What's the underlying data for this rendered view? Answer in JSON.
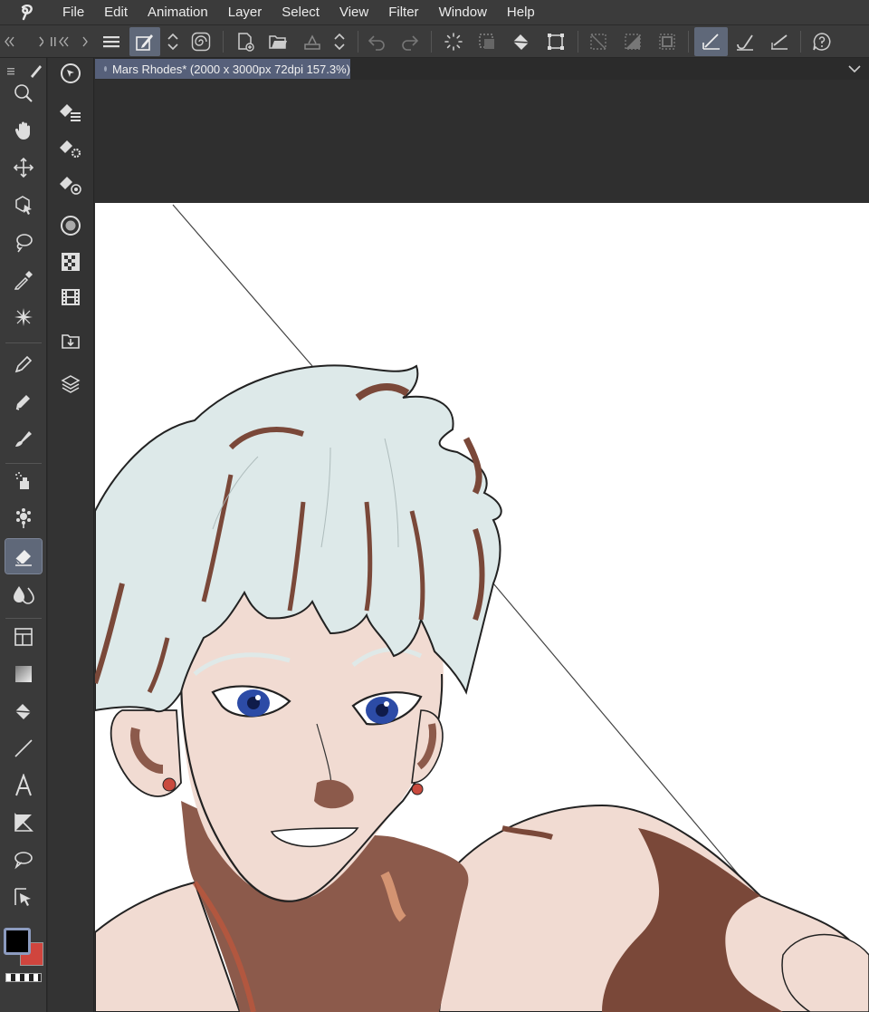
{
  "app": {
    "menu": [
      "File",
      "Edit",
      "Animation",
      "Layer",
      "Select",
      "View",
      "Filter",
      "Window",
      "Help"
    ]
  },
  "toolbar": {
    "buttons": [
      "menu-icon",
      "edit-mode-icon",
      "updown-icon",
      "spiral-icon",
      "new-file-icon",
      "open-file-icon",
      "save-icon",
      "updown-icon",
      "undo-icon",
      "redo-icon",
      "loading-icon",
      "select-icon",
      "fill-icon",
      "transform-icon",
      "deselect-icon",
      "invert-icon",
      "border-icon",
      "snap-ruler-icon",
      "brush-icon",
      "snap-special-icon",
      "help-icon"
    ],
    "active": [
      "edit-mode-icon",
      "snap-ruler-icon"
    ]
  },
  "document": {
    "tab_title": "Mars Rhodes* (2000 x 3000px 72dpi 157.3%)"
  },
  "tools": {
    "items": [
      "zoom-icon",
      "hand-icon",
      "move-icon",
      "object-select-icon",
      "lasso-icon",
      "eyedropper-icon",
      "sparkle-icon",
      "pen-icon",
      "pencil-icon",
      "brush-pen-icon",
      "airbrush-icon",
      "decoration-icon",
      "eraser-icon",
      "blend-icon",
      "frame-icon",
      "gradient-icon",
      "fill-icon",
      "line-icon",
      "text-icon",
      "ruler-icon",
      "balloon-icon",
      "correct-line-icon"
    ],
    "active": "eraser-icon"
  },
  "colors": {
    "main": "#000000",
    "sub": "#d0453e",
    "accent": "#5f6879"
  },
  "subtools": [
    "eraser-layer-icon",
    "eraser-settings-icon",
    "eraser-target-icon",
    "circle-tool-icon",
    "checker-icon",
    "film-icon",
    "import-icon",
    "layers-icon"
  ]
}
